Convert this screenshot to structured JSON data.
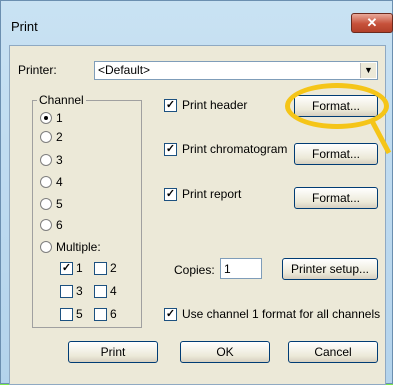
{
  "window": {
    "title": "Print",
    "close_icon": "close-icon"
  },
  "printer": {
    "label": "Printer:",
    "value": "<Default>"
  },
  "channel": {
    "legend": "Channel",
    "options": [
      "1",
      "2",
      "3",
      "4",
      "5",
      "6",
      "Multiple:"
    ],
    "selected": "1",
    "multi": [
      {
        "label": "1",
        "checked": true
      },
      {
        "label": "2",
        "checked": false
      },
      {
        "label": "3",
        "checked": false
      },
      {
        "label": "4",
        "checked": false
      },
      {
        "label": "5",
        "checked": false
      },
      {
        "label": "6",
        "checked": false
      }
    ]
  },
  "print_options": [
    {
      "label": "Print header",
      "checked": true,
      "button": "Format..."
    },
    {
      "label": "Print chromatogram",
      "checked": true,
      "button": "Format..."
    },
    {
      "label": "Print report",
      "checked": true,
      "button": "Format..."
    }
  ],
  "copies": {
    "label": "Copies:",
    "value": "1"
  },
  "printer_setup": "Printer setup...",
  "use_channel_format": {
    "label": "Use channel 1 format for all channels",
    "checked": true
  },
  "buttons": {
    "print": "Print",
    "ok": "OK",
    "cancel": "Cancel"
  },
  "colors": {
    "highlight": "#f5c518",
    "background": "#ece9d8"
  }
}
